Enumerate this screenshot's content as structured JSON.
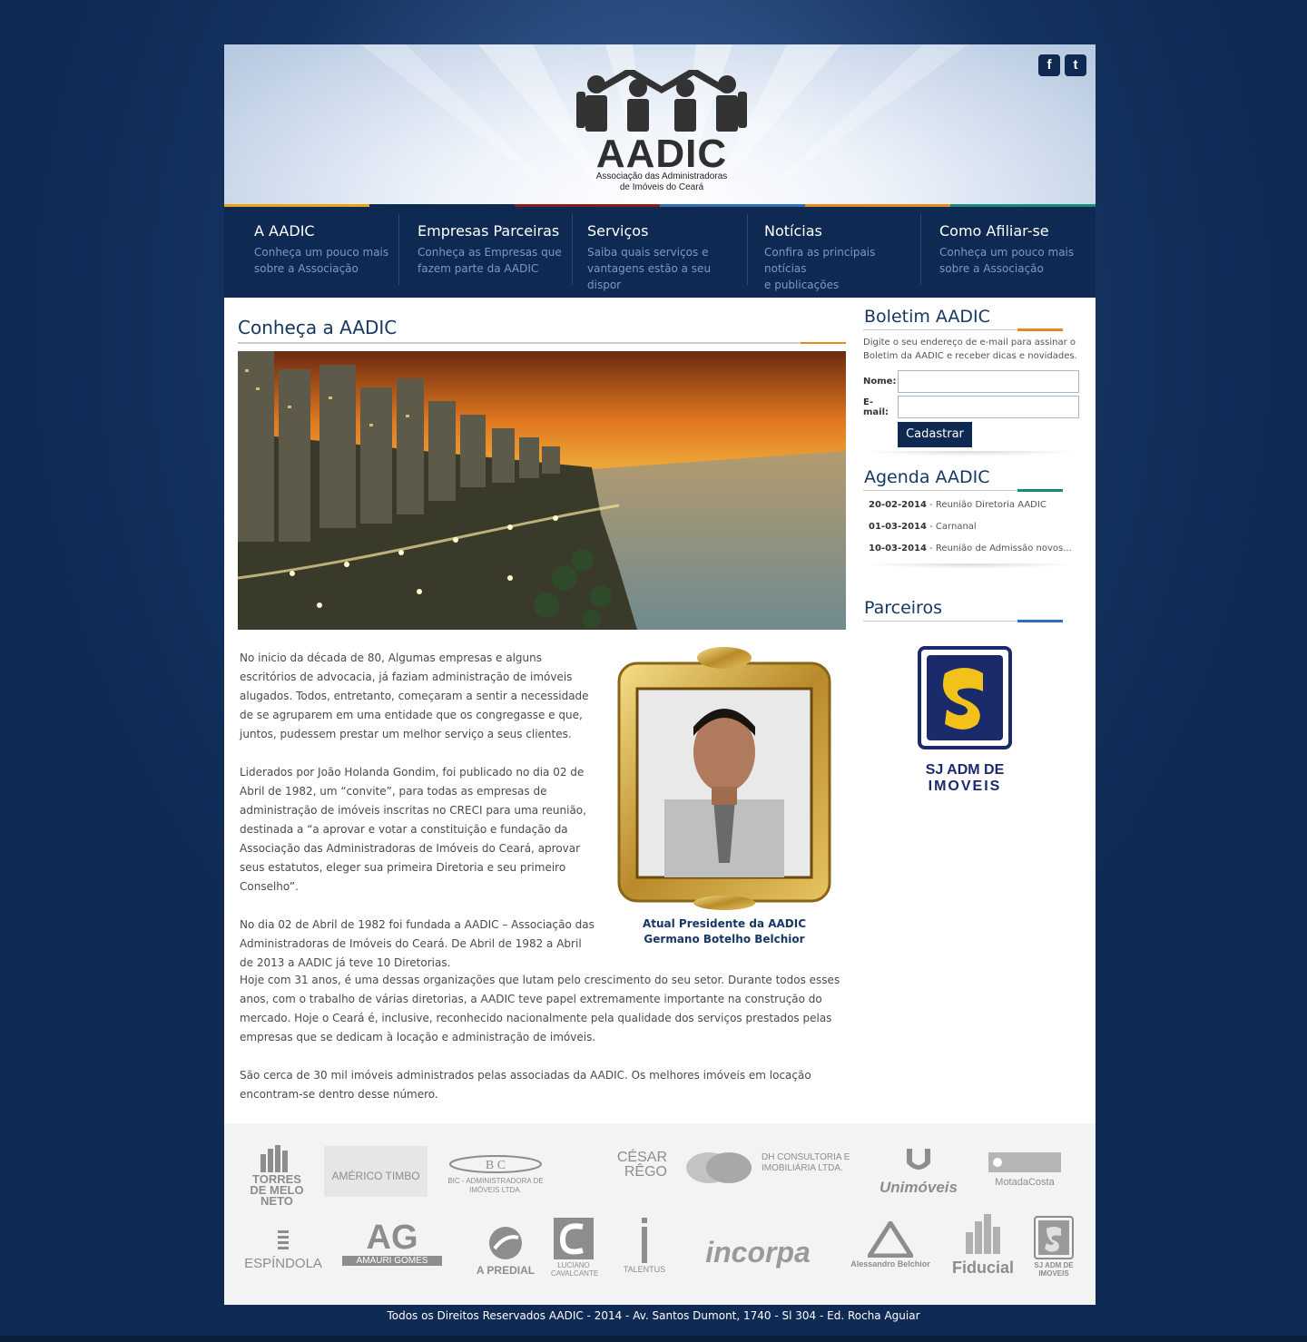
{
  "header": {
    "logo_name": "AADIC",
    "logo_tagline_line1": "Associação das Administradoras",
    "logo_tagline_line2": "de Imóveis do Ceará",
    "social": [
      {
        "icon": "facebook-icon",
        "glyph": "f"
      },
      {
        "icon": "twitter-icon",
        "glyph": "t"
      }
    ],
    "colorbar": [
      "#e8a317",
      "#0f2a52",
      "#8c1c1c",
      "#2f6fb5",
      "#e38b1d"
    ]
  },
  "nav": [
    {
      "title": "A AADIC",
      "desc1": "Conheça um pouco mais",
      "desc2": "sobre a Associação"
    },
    {
      "title": "Empresas Parceiras",
      "desc1": "Conheça as Empresas que",
      "desc2": "fazem parte da AADIC"
    },
    {
      "title": "Serviços",
      "desc1": "Saiba quais serviços e",
      "desc2": "vantagens estão a seu dispor"
    },
    {
      "title": "Notícias",
      "desc1": "Confira as principais notícias",
      "desc2": "e publicações"
    },
    {
      "title": "Como Afiliar-se",
      "desc1": "Conheça um pouco mais",
      "desc2": "sobre a Associação"
    }
  ],
  "main": {
    "title": "Conheça a AADIC",
    "accent_color": "#e38b1d",
    "paragraphs_left": [
      "No inicio da década de 80, Algumas empresas e alguns escritórios de advocacia, já faziam administração de imóveis alugados. Todos, entretanto, começaram a sentir a necessidade de se agruparem em uma entidade que os congregasse e que, juntos, pudessem prestar um melhor serviço a seus clientes.",
      "Liderados por João Holanda Gondim, foi publicado no dia 02 de Abril de 1982, um “convite”, para todas as empresas de administração de imóveis inscritas no CRECI para uma reunião, destinada a “a aprovar e votar a constituição e fundação da Associação das Administradoras de Imóveis do Ceará, aprovar seus estatutos, eleger sua primeira Diretoria e seu primeiro Conselho”.",
      "No dia 02 de Abril de 1982 foi fundada a AADIC – Associação das Administradoras de Imóveis do Ceará. De Abril de 1982 a Abril de 2013 a AADIC já teve 10 Diretorias."
    ],
    "paragraphs_full": [
      "Hoje com 31 anos, é uma dessas organizações que lutam pelo crescimento do seu setor. Durante todos esses anos, com o trabalho de várias diretorias, a AADIC teve papel extremamente importante na construção do mercado. Hoje o Ceará é, inclusive, reconhecido nacionalmente pela qualidade dos serviços prestados pelas empresas que se dedicam à locação e administração de imóveis.",
      "São cerca de 30 mil imóveis administrados pelas associadas da AADIC. Os melhores imóveis em locação encontram-se dentro desse número."
    ],
    "caption_line1": "Atual Presidente da AADIC",
    "caption_line2": "Germano Botelho Belchior"
  },
  "sidebar": {
    "newsletter": {
      "title": "Boletim AADIC",
      "accent_color": "#e38b1d",
      "note": "Digite o seu endereço de e-mail para assinar o Boletim da AADIC e receber dicas e novidades.",
      "name_label": "Nome:",
      "email_label": "E-mail:",
      "submit": "Cadastrar"
    },
    "agenda": {
      "title": "Agenda AADIC",
      "accent_color": "#1a8a78",
      "items": [
        {
          "date": "20-02-2014",
          "text": " - Reunião Diretoria AADIC"
        },
        {
          "date": "01-03-2014",
          "text": " - Carnanal"
        },
        {
          "date": "10-03-2014",
          "text": " - Reunião de Admissão novos..."
        }
      ]
    },
    "partners": {
      "title": "Parceiros",
      "accent_color": "#2f6fb5",
      "featured_line1": "SJ ADM DE",
      "featured_line2": "IMOVEIS"
    }
  },
  "partner_logos": {
    "row1": [
      "TORRES DE MELO NETO",
      "AMÉRICO TIMBO",
      "BIC - ADMINISTRADORA DE IMÓVEIS LTDA.",
      "CÉSAR RÊGO",
      "DH CONSULTORIA E IMOBILIÁRIA LTDA.",
      "Unimóveis",
      "MotadaCosta"
    ],
    "row2": [
      "ESPÍNDOLA",
      "AMAURI GOMES",
      "A PREDIAL",
      "LUCIANO CAVALCANTE",
      "TALENTUS",
      "incorpa",
      "Alessandro Belchior",
      "Fiducial",
      "SJ ADM DE IMOVEIS"
    ]
  },
  "footer": {
    "text": "Todos os Direitos Reservados AADIC - 2014 - Av. Santos Dumont, 1740 - Sl 304 -  Ed. Rocha Aguiar"
  }
}
